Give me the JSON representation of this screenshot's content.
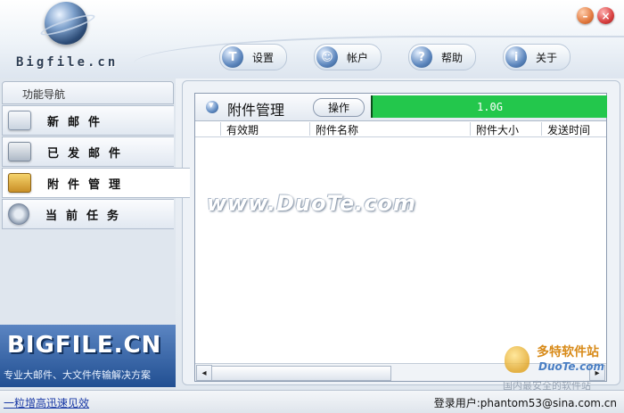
{
  "header": {
    "brand": "Bigfile.cn",
    "minimize_icon": "minimize-icon",
    "close_icon": "close-icon"
  },
  "toolbar": {
    "items": [
      {
        "label": "设置",
        "icon": "settings-icon",
        "glyph": "T"
      },
      {
        "label": "帐户",
        "icon": "account-icon",
        "glyph": "☺"
      },
      {
        "label": "帮助",
        "icon": "help-icon",
        "glyph": "?"
      },
      {
        "label": "关于",
        "icon": "info-icon",
        "glyph": "i"
      }
    ]
  },
  "sidebar": {
    "title": "功能导航",
    "items": [
      {
        "label": "新邮件",
        "icon": "mail-icon"
      },
      {
        "label": "已发邮件",
        "icon": "sent-mail-icon"
      },
      {
        "label": "附件管理",
        "icon": "attachment-icon",
        "active": true
      },
      {
        "label": "当前任务",
        "icon": "task-icon"
      }
    ],
    "promo": {
      "title": "BIGFILE.CN",
      "subtitle": "专业大邮件、大文件传输解决方案"
    }
  },
  "panel": {
    "title": "附件管理",
    "operate_button": "操作",
    "quota": "1.0G",
    "columns": [
      "有效期",
      "附件名称",
      "附件大小",
      "发送时间"
    ]
  },
  "watermark": "www.DuoTe.com",
  "corner_logo": {
    "line1": "多特软件站",
    "line2": "DuoTe.com",
    "line3": "国内最安全的软件站"
  },
  "statusbar": {
    "link": "一粒增高迅速见效",
    "user_label": "登录用户:",
    "user_email": "phantom53@sina.com.cn"
  },
  "colors": {
    "quota_bar": "#23c74c",
    "link": "#1a3aa6",
    "promo_bg": "#214f92"
  }
}
